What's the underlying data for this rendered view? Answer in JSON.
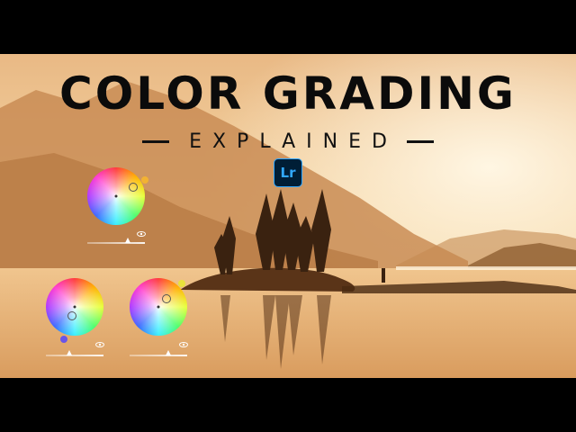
{
  "title": "COLOR GRADING",
  "subtitle": "EXPLAINED",
  "logo_text": "Lr",
  "wheels": [
    {
      "name": "top-wheel",
      "handle_color": "#f2b233"
    },
    {
      "name": "bottom-left-wheel",
      "handle_color": "#6a55e8"
    },
    {
      "name": "bottom-right-wheel",
      "handle_color": "#e8e23b"
    }
  ],
  "icons": [
    "eye-icon"
  ],
  "colors": {
    "sky": "#f6d9a8",
    "water": "#e9b983",
    "logo_bg": "#001e36",
    "logo_accent": "#31a8ff"
  }
}
